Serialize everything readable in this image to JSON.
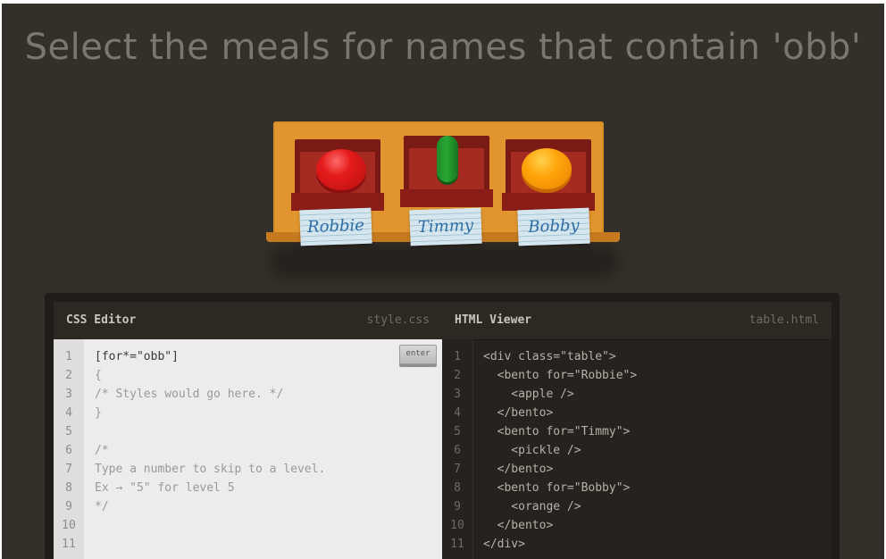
{
  "order": {
    "text": "Select the meals for names that contain 'obb'"
  },
  "table": {
    "bentos": [
      {
        "name": "Robbie",
        "content": "apple"
      },
      {
        "name": "Timmy",
        "content": "pickle"
      },
      {
        "name": "Bobby",
        "content": "orange"
      }
    ]
  },
  "css_editor": {
    "title": "CSS Editor",
    "filename": "style.css",
    "enter_label": "enter",
    "line_numbers": [
      "1",
      "2",
      "3",
      "4",
      "5",
      "6",
      "7",
      "8",
      "9",
      "10",
      "11"
    ],
    "lines": [
      "[for*=\"obb\"]",
      "{",
      "/* Styles would go here. */",
      "}",
      "",
      "/*",
      "Type a number to skip to a level.",
      "Ex → \"5\" for level 5",
      "*/",
      "",
      ""
    ]
  },
  "html_viewer": {
    "title": "HTML Viewer",
    "filename": "table.html",
    "line_numbers": [
      "1",
      "2",
      "3",
      "4",
      "5",
      "6",
      "7",
      "8",
      "9",
      "10",
      "11"
    ],
    "lines": [
      "<div class=\"table\">",
      "  <bento for=\"Robbie\">",
      "    <apple />",
      "  </bento>",
      "  <bento for=\"Timmy\">",
      "    <pickle />",
      "  </bento>",
      "  <bento for=\"Bobby\">",
      "    <orange />",
      "  </bento>",
      "</div>"
    ]
  }
}
